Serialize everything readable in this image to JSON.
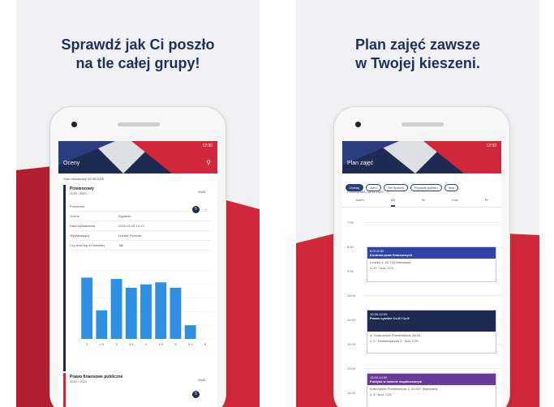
{
  "left": {
    "headline": [
      "Sprawdź jak Ci poszło",
      "na tle całej grupy!"
    ],
    "screen_title": "Oceny",
    "status_time": "12:30",
    "updated": "Stan aktualizacji 09.05.2018",
    "course1": {
      "name": "Przewozowy",
      "year": "2020 / 2021",
      "type": "Wykł.",
      "rows": [
        {
          "k": "Przedmiot",
          "v": ""
        },
        {
          "k": "Ocena",
          "v": "Egzamin"
        },
        {
          "k": "Data wystawienia",
          "v": "2020-01-28 13:13"
        },
        {
          "k": "Wystawiający",
          "v": "Łukasz Pietrzak"
        },
        {
          "k": "Czy brać się do średniej",
          "v": "Tak"
        }
      ],
      "badge": "5"
    },
    "course2": {
      "name": "Prawo finansowe publiczne",
      "year": "2020 / 2021",
      "type": "Wykł.",
      "badge": "5"
    },
    "chart_data": {
      "type": "bar",
      "categories": [
        "2",
        "2.5",
        "3",
        "3.5",
        "4",
        "4.5",
        "5",
        "5.5",
        "6"
      ],
      "series": [
        {
          "values": [
            90,
            42,
            88,
            75,
            80,
            83,
            75,
            20,
            0
          ]
        }
      ],
      "ylim": [
        0,
        100
      ]
    }
  },
  "right": {
    "headline": [
      "Plan zajęć zawsze",
      "w Twojej kieszeni."
    ],
    "screen_title": "Plan zajęć",
    "status_time": "12:30",
    "chips": [
      "Dzisiaj",
      "Jutro",
      "Ten tydzień",
      "Przyszły tydzień",
      "Inny"
    ],
    "date": "Poniedziałek, 18.11.2019",
    "tabs": [
      "Dzień",
      "Wt",
      "Śr",
      "Czw",
      "Pt"
    ],
    "hours": [
      "7:00",
      "8:00",
      "9:00",
      "10:00",
      "11:00",
      "12:00",
      "13:00",
      "14:00"
    ],
    "events": [
      {
        "time": "8:00-9:30",
        "title": "Kontrola praw finansowych",
        "loc": "Łódzka 4, 26-700 Warszawa",
        "room": "s. 47 · bud. 17/3",
        "color": "#2f44a8"
      },
      {
        "time": "10:30-12:00",
        "title": "Prawo cywilne Cz.8 i Cz.9",
        "loc": "ul. Krakowskie Przedmieście 26/28",
        "room": "s. 5 · Uniwersytecka 4 · bud. 7/26",
        "color": "#1e2a52"
      },
      {
        "time": "13:00-14:30",
        "title": "Polityka w świecie współczesnym",
        "loc": "Krakowskie Przedmieście 3, 00-047 Warszawa",
        "room": "s. 4 · bud. 7/26",
        "color": "#6a3a9a"
      }
    ]
  },
  "colors": {
    "navy": "#1e2a52",
    "red": "#d0283a",
    "blue": "#2f8fe3",
    "purple": "#6a3a9a"
  }
}
